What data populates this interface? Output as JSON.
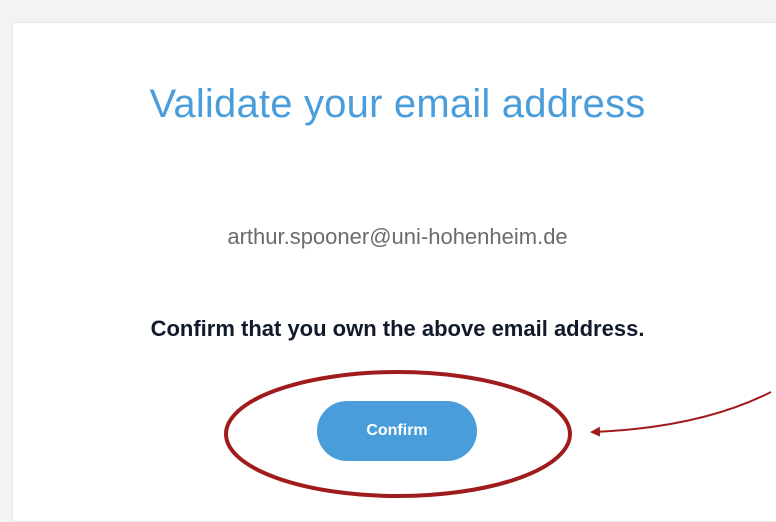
{
  "page": {
    "title": "Validate your email address",
    "email": "arthur.spooner@uni-hohenheim.de",
    "instruction": "Confirm that you own the above email address.",
    "confirm_label": "Confirm"
  },
  "colors": {
    "accent": "#4a9ddb",
    "annotation": "#a01c1c"
  }
}
